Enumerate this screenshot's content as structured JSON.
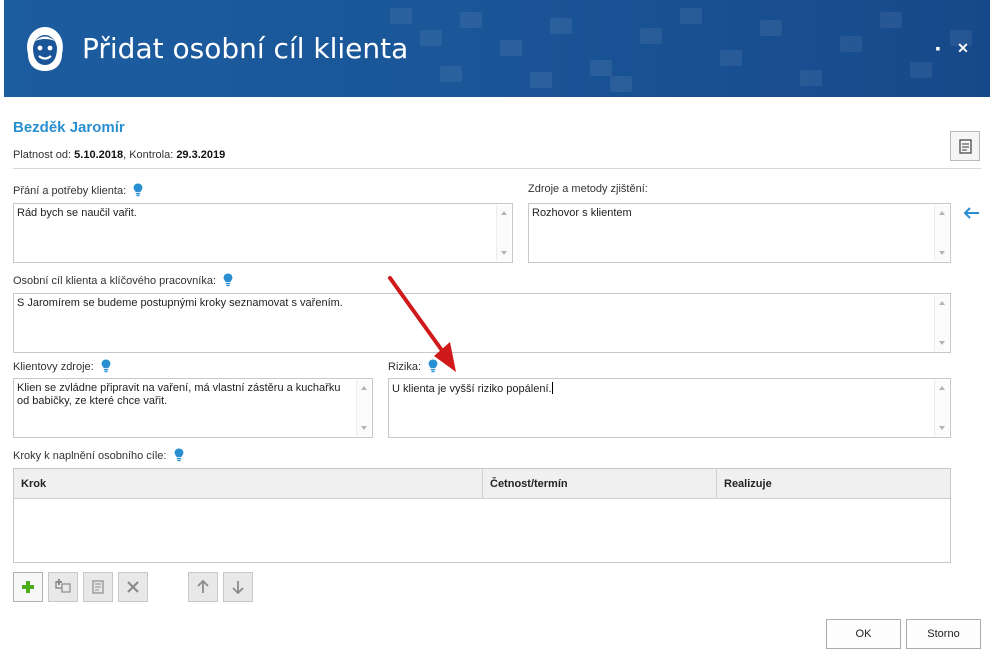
{
  "window": {
    "title": "Přidat osobní cíl klienta",
    "maximize_label": "▪",
    "close_label": "✕"
  },
  "client": {
    "name": "Bezděk Jaromír",
    "validity_label": "Platnost od:",
    "validity_from": "5.10.2018",
    "control_label": "Kontrola:",
    "control_date": "29.3.2019"
  },
  "fields": {
    "wishes": {
      "label": "Přání a potřeby klienta:",
      "value": "Rád bych se naučil vařit."
    },
    "sources": {
      "label": "Zdroje a metody zjištění:",
      "value": "Rozhovor s klientem"
    },
    "goal": {
      "label": "Osobní cíl klienta a klíčového pracovníka:",
      "value": "S Jaromírem se budeme postupnými kroky seznamovat s vařením."
    },
    "client_resources": {
      "label": "Klientovy zdroje:",
      "value": "Klien se zvládne připravit na vaření, má vlastní zástěru a kuchařku od babičky, ze které chce vařit."
    },
    "risks": {
      "label": "Rizika:",
      "value": "U klienta je vyšší riziko popálení."
    }
  },
  "steps": {
    "label": "Kroky k naplnění osobního cíle:",
    "columns": [
      "Krok",
      "Četnost/termín",
      "Realizuje"
    ],
    "rows": []
  },
  "toolbar": {
    "icons": [
      "add-icon",
      "add-sub-icon",
      "edit-icon",
      "delete-icon",
      "move-up-icon",
      "move-down-icon"
    ]
  },
  "buttons": {
    "ok": "OK",
    "cancel": "Storno"
  },
  "colors": {
    "header": "#1a5597",
    "accent": "#2a8fd0",
    "add_green": "#4caf1a",
    "annotation": "#d0191b"
  }
}
